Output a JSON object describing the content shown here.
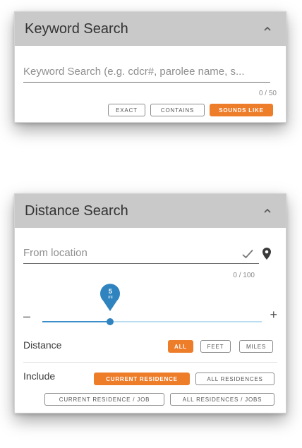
{
  "keyword_search": {
    "title": "Keyword Search",
    "placeholder": "Keyword Search (e.g. cdcr#, parolee name, s...",
    "counter": "0 / 50",
    "modes": [
      "EXACT",
      "CONTAINS",
      "SOUNDS LIKE"
    ],
    "active_mode": "SOUNDS LIKE"
  },
  "distance_search": {
    "title": "Distance Search",
    "location_placeholder": "From location",
    "counter": "0 / 100",
    "slider": {
      "value": 5,
      "value_label": "5",
      "unit_label": "mi",
      "minus": "–",
      "plus": "+",
      "fraction": 0.31
    },
    "distance_label": "Distance",
    "units": [
      "ALL",
      "FEET",
      "MILES"
    ],
    "active_unit": "ALL",
    "include_label": "Include",
    "include_options": [
      "CURRENT RESIDENCE",
      "ALL RESIDENCES",
      "CURRENT RESIDENCE / JOB",
      "ALL RESIDENCES / JOBS"
    ],
    "active_include": "CURRENT RESIDENCE"
  },
  "colors": {
    "accent": "#ee7d2a",
    "slider_blue": "#3a8fc8",
    "header_gray": "#c9c9c9"
  },
  "icons": [
    "chevron-up-icon",
    "checkmark-icon",
    "map-pin-icon"
  ]
}
